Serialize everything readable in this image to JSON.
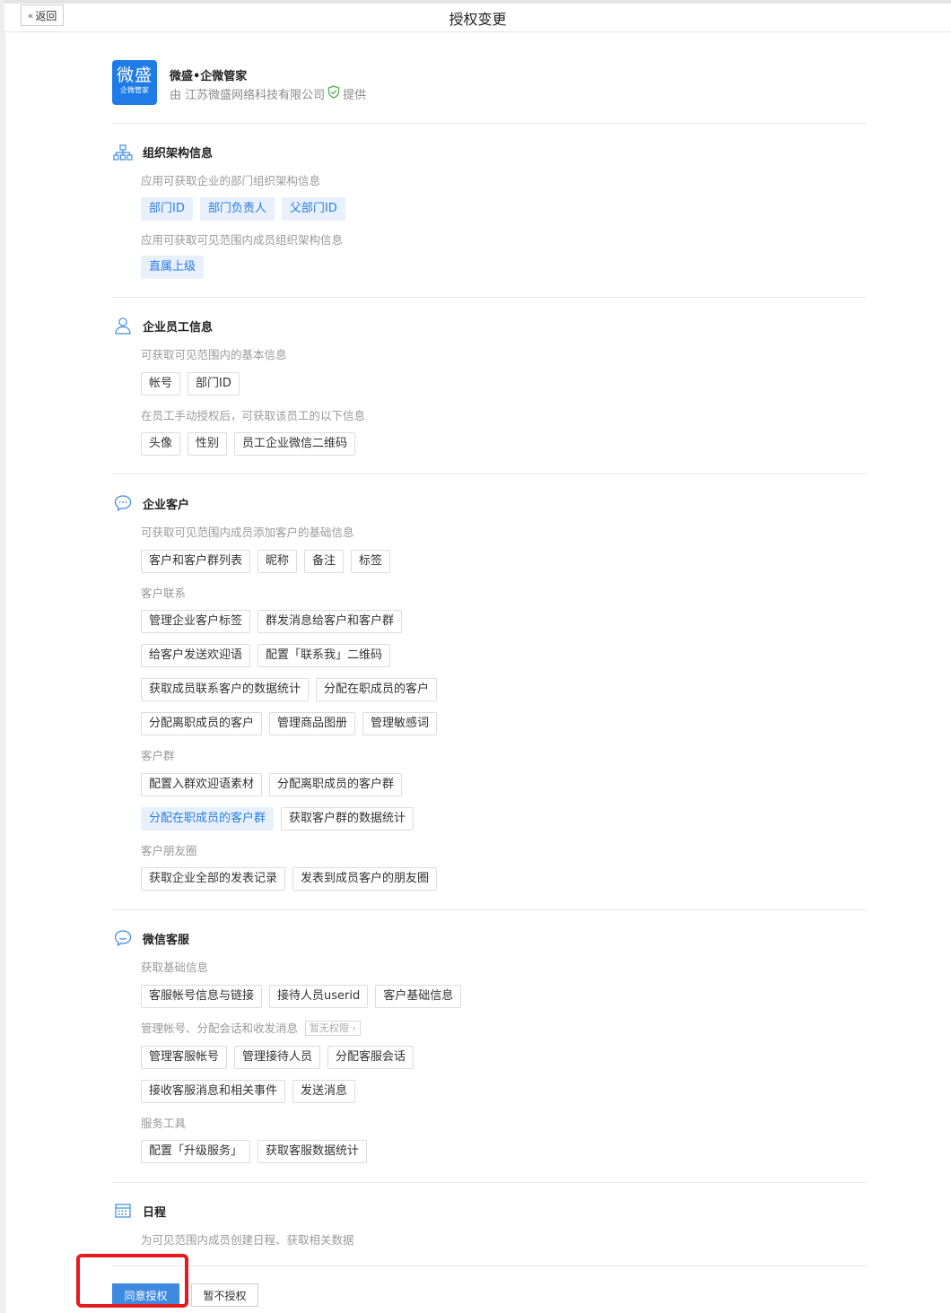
{
  "topbar": {
    "back_label": "返回",
    "title": "授权变更"
  },
  "app": {
    "logo_main": "微盛",
    "logo_sub": "企微管家",
    "name": "微盛•企微管家",
    "provider_prefix": "由 江苏微盛网络科技有限公司",
    "provider_suffix": "提供"
  },
  "sections": {
    "org": {
      "title": "组织架构信息",
      "sub1": "应用可获取企业的部门组织架构信息",
      "tags1": [
        "部门ID",
        "部门负责人",
        "父部门ID"
      ],
      "sub2": "应用可获取可见范围内成员组织架构信息",
      "tags2": [
        "直属上级"
      ]
    },
    "staff": {
      "title": "企业员工信息",
      "sub1": "可获取可见范围内的基本信息",
      "tags1": [
        "帐号",
        "部门ID"
      ],
      "sub2": "在员工手动授权后，可获取该员工的以下信息",
      "tags2": [
        "头像",
        "性别",
        "员工企业微信二维码"
      ]
    },
    "customer": {
      "title": "企业客户",
      "sub1": "可获取可见范围内成员添加客户的基础信息",
      "tags1": [
        "客户和客户群列表",
        "昵称",
        "备注",
        "标签"
      ],
      "sub2": "客户联系",
      "tags2a": [
        "管理企业客户标签",
        "群发消息给客户和客户群"
      ],
      "tags2b": [
        "给客户发送欢迎语",
        "配置「联系我」二维码"
      ],
      "tags2c": [
        "获取成员联系客户的数据统计",
        "分配在职成员的客户"
      ],
      "tags2d": [
        "分配离职成员的客户",
        "管理商品图册",
        "管理敏感词"
      ],
      "sub3": "客户群",
      "tags3a": [
        "配置入群欢迎语素材",
        "分配离职成员的客户群"
      ],
      "tags3b": [
        "分配在职成员的客户群",
        "获取客户群的数据统计"
      ],
      "sub4": "客户朋友圈",
      "tags4": [
        "获取企业全部的发表记录",
        "发表到成员客户的朋友圈"
      ]
    },
    "kf": {
      "title": "微信客服",
      "sub1": "获取基础信息",
      "tags1": [
        "客服帐号信息与链接",
        "接待人员userid",
        "客户基础信息"
      ],
      "sub2": "管理帐号、分配会话和收发消息",
      "sub2_badge": "暂无权限 ›",
      "tags2a": [
        "管理客服帐号",
        "管理接待人员",
        "分配客服会话"
      ],
      "tags2b": [
        "接收客服消息和相关事件",
        "发送消息"
      ],
      "sub3": "服务工具",
      "tags3": [
        "配置「升级服务」",
        "获取客服数据统计"
      ]
    },
    "schedule": {
      "title": "日程",
      "sub1": "为可见范围内成员创建日程、获取相关数据"
    }
  },
  "actions": {
    "agree": "同意授权",
    "decline": "暂不授权"
  },
  "colors": {
    "primary": "#3d8ae0",
    "brand_blue": "#1f7be6",
    "highlight": "#e8191c",
    "tag_blue_bg": "#e8f1fb",
    "verified_green": "#4caf50"
  }
}
